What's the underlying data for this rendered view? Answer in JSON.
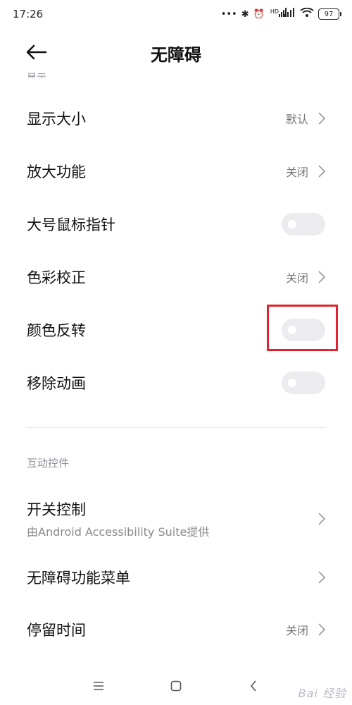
{
  "status_bar": {
    "time": "17:26",
    "network": "HD",
    "battery": "97"
  },
  "header": {
    "title": "无障碍"
  },
  "partial_section": "显示",
  "items": [
    {
      "label": "显示大小",
      "value": "默认",
      "kind": "chevron"
    },
    {
      "label": "放大功能",
      "value": "关闭",
      "kind": "chevron"
    },
    {
      "label": "大号鼠标指针",
      "kind": "toggle",
      "checked": false
    },
    {
      "label": "色彩校正",
      "value": "关闭",
      "kind": "chevron"
    },
    {
      "label": "颜色反转",
      "kind": "toggle",
      "checked": false
    },
    {
      "label": "移除动画",
      "kind": "toggle",
      "checked": false
    }
  ],
  "interaction_section": {
    "label": "互动控件",
    "items": [
      {
        "label": "开关控制",
        "subtitle": "由Android Accessibility Suite提供"
      },
      {
        "label": "无障碍功能菜单"
      },
      {
        "label": "停留时间",
        "value": "关闭"
      }
    ]
  },
  "watermark": "Bai 经验",
  "colors": {
    "highlight": "#e0232e",
    "toggle_off": "#ececf0",
    "secondary_text": "#8e8e9b"
  }
}
